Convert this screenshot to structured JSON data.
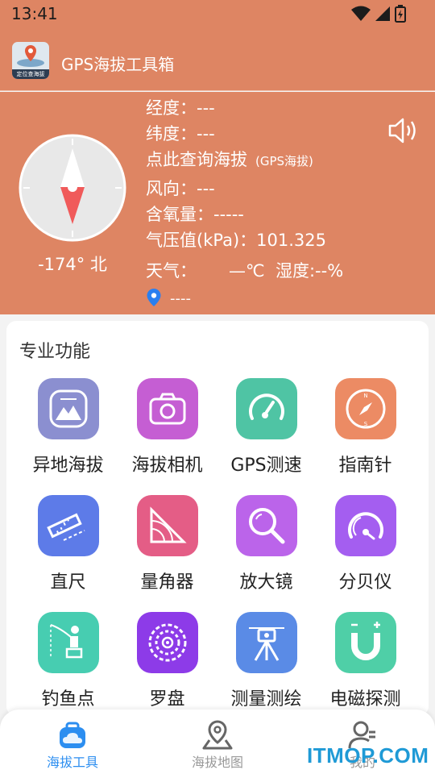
{
  "status_bar": {
    "time": "13:41"
  },
  "app_bar": {
    "title": "GPS海拔工具箱",
    "logo_text": "定位查海拔"
  },
  "info": {
    "longitude": "经度：---",
    "latitude": "纬度：---",
    "altitude_query": "点此查询海拔",
    "altitude_tag": "(GPS海拔)",
    "wind": "风向：---",
    "oxygen": "含氧量：-----",
    "pressure": "气压值(kPa)：101.325",
    "weather": "天气：      —℃  湿度:--%",
    "location": "----",
    "compass_reading": "-174° 北"
  },
  "features": {
    "section_title": "专业功能",
    "items": [
      {
        "id": "remote-altitude",
        "label": "异地海拔",
        "icon": "mountain-frame-icon",
        "color": "#8b8fd0"
      },
      {
        "id": "altitude-camera",
        "label": "海拔相机",
        "icon": "camera-icon",
        "color": "#c55ed3"
      },
      {
        "id": "gps-speed",
        "label": "GPS测速",
        "icon": "speedometer-icon",
        "color": "#4fc4a4"
      },
      {
        "id": "compass",
        "label": "指南针",
        "icon": "compass-icon",
        "color": "#ec8b64"
      },
      {
        "id": "ruler",
        "label": "直尺",
        "icon": "ruler-icon",
        "color": "#5d7be8"
      },
      {
        "id": "protractor",
        "label": "量角器",
        "icon": "protractor-icon",
        "color": "#e45d86"
      },
      {
        "id": "magnifier",
        "label": "放大镜",
        "icon": "magnifier-icon",
        "color": "#bb64ea"
      },
      {
        "id": "decibel",
        "label": "分贝仪",
        "icon": "decibel-meter-icon",
        "color": "#a45ef0"
      },
      {
        "id": "fishing-spot",
        "label": "钓鱼点",
        "icon": "fishing-icon",
        "color": "#47cdb1"
      },
      {
        "id": "luopan",
        "label": "罗盘",
        "icon": "luopan-icon",
        "color": "#8d3be8"
      },
      {
        "id": "survey",
        "label": "测量测绘",
        "icon": "surveying-instrument-icon",
        "color": "#5a8be6"
      },
      {
        "id": "magnetic",
        "label": "电磁探测",
        "icon": "magnet-icon",
        "color": "#4fcfa7"
      }
    ]
  },
  "bottom_nav": {
    "items": [
      {
        "label": "海拔工具",
        "icon": "toolbox-icon",
        "active": true
      },
      {
        "label": "海拔地图",
        "icon": "map-pin-icon",
        "active": false
      },
      {
        "label": "我的",
        "icon": "profile-icon",
        "active": false
      }
    ]
  },
  "watermark": "ITMOP.COM",
  "colors": {
    "accent": "#de8563",
    "active_tab": "#2c8ef0",
    "inactive_tab": "#999999"
  }
}
